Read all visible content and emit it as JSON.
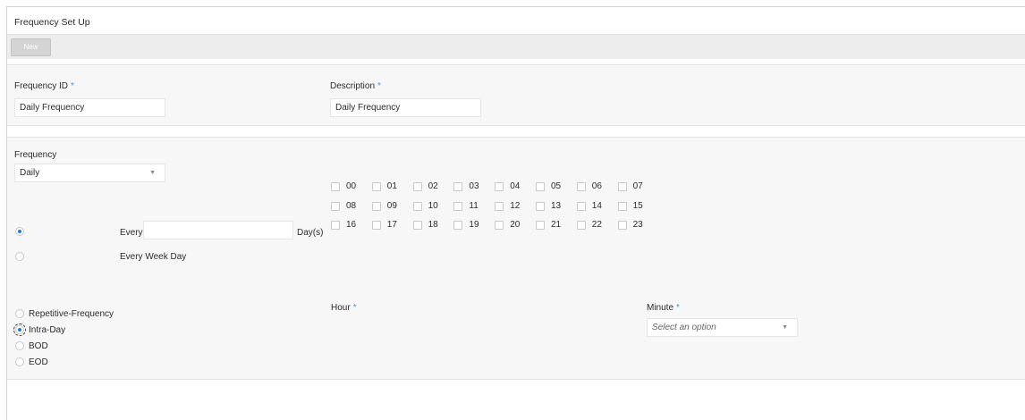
{
  "page": {
    "title": "Frequency Set Up"
  },
  "toolbar": {
    "new_label": "New"
  },
  "header_fields": {
    "frequency_id": {
      "label": "Frequency ID",
      "required": "*",
      "value": "Daily Frequency"
    },
    "description": {
      "label": "Description",
      "required": "*",
      "value": "Daily Frequency"
    }
  },
  "frequency": {
    "label": "Frequency",
    "selected": "Daily",
    "caret": "▼"
  },
  "day_options": {
    "every_label": "Every",
    "every_value": "",
    "days_suffix": "Day(s)",
    "every_week_day_label": "Every Week Day",
    "selected": "every"
  },
  "run_type": {
    "options": [
      "Repetitive-Frequency",
      "Intra-Day",
      "BOD",
      "EOD"
    ],
    "selected": "Intra-Day"
  },
  "hour": {
    "label": "Hour",
    "required": "*",
    "values": [
      "00",
      "01",
      "02",
      "03",
      "04",
      "05",
      "06",
      "07",
      "08",
      "09",
      "10",
      "11",
      "12",
      "13",
      "14",
      "15",
      "16",
      "17",
      "18",
      "19",
      "20",
      "21",
      "22",
      "23"
    ],
    "checked": []
  },
  "minute": {
    "label": "Minute",
    "required": "*",
    "placeholder": "Select an option",
    "caret": "▼"
  },
  "colors": {
    "accent": "#1f7ae0",
    "required_star": "#4a90e2",
    "panel_bg": "#f7f7f7",
    "toolbar_bg": "#ededed"
  }
}
